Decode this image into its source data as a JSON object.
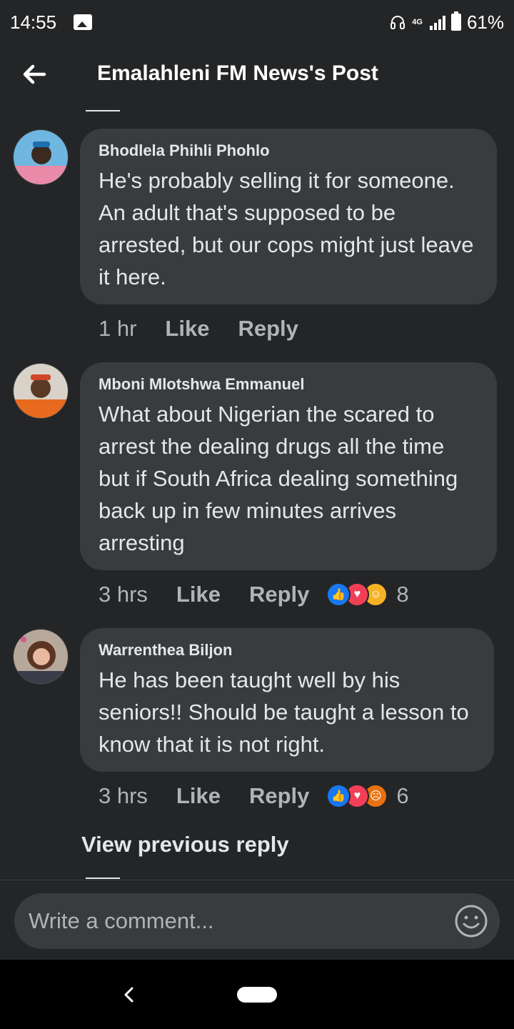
{
  "status_bar": {
    "time": "14:55",
    "network": "4G",
    "battery": "61%"
  },
  "header": {
    "title": "Emalahleni FM News's Post"
  },
  "comments": [
    {
      "author": "Bhodlela Phihli Phohlo",
      "text": "He's probably selling it for someone. An adult that's supposed to be arrested, but our cops might just leave it here.",
      "time": "1 hr",
      "like": "Like",
      "reply": "Reply",
      "reactions": [],
      "reaction_count": ""
    },
    {
      "author": "Mboni Mlotshwa Emmanuel",
      "text": "What about Nigerian the scared to arrest the dealing drugs all the time but if South Africa dealing something back up in few minutes arrives arresting",
      "time": "3 hrs",
      "like": "Like",
      "reply": "Reply",
      "reactions": [
        "like-icon",
        "love-icon",
        "haha-icon"
      ],
      "reaction_count": "8"
    },
    {
      "author": "Warrenthea Biljon",
      "text": "He has been taught well by his seniors!! Should be taught a lesson to know that it is not right.",
      "time": "3 hrs",
      "like": "Like",
      "reply": "Reply",
      "reactions": [
        "like-icon",
        "love-icon",
        "angry-icon"
      ],
      "reaction_count": "6"
    }
  ],
  "view_previous": "View previous reply",
  "composer": {
    "placeholder": "Write a comment..."
  },
  "colors": {
    "background": "#242526",
    "bubble": "#3a3b3c",
    "text": "#e4e6eb",
    "secondary": "#b0b3b8",
    "like_blue": "#1877f2",
    "love_red": "#f33e58",
    "haha_yellow": "#f7b125",
    "angry_orange": "#e9710f"
  }
}
